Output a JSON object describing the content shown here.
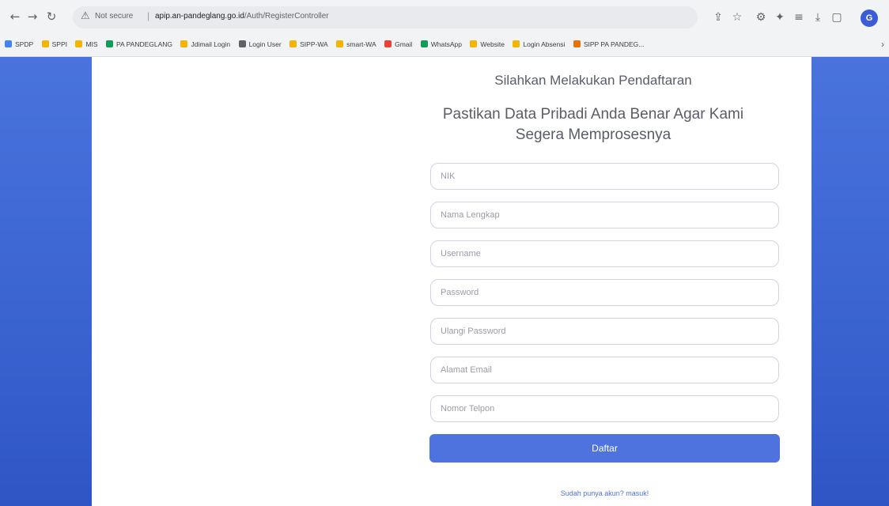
{
  "browser": {
    "security_label": "Not secure",
    "url_host": "apip.an-pandeglang.go.id",
    "url_path": "/Auth/RegisterController",
    "profile_initial": "G"
  },
  "bookmarks": [
    {
      "label": "SPDP",
      "color": "#4285f4"
    },
    {
      "label": "SPPI",
      "color": "#f4b400"
    },
    {
      "label": "MIS",
      "color": "#f4b400"
    },
    {
      "label": "PA PANDEGLANG",
      "color": "#0f9d58"
    },
    {
      "label": "Jdimail Login",
      "color": "#f4b400"
    },
    {
      "label": "Login User",
      "color": "#5f6368"
    },
    {
      "label": "SIPP-WA",
      "color": "#f4b400"
    },
    {
      "label": "smart-WA",
      "color": "#f4b400"
    },
    {
      "label": "Gmail",
      "color": "#ea4335"
    },
    {
      "label": "WhatsApp",
      "color": "#0f9d58"
    },
    {
      "label": "Website",
      "color": "#f4b400"
    },
    {
      "label": "Login Absensi",
      "color": "#f4b400"
    },
    {
      "label": "SIPP PA PANDEG...",
      "color": "#e8710a"
    }
  ],
  "form": {
    "heading": "Silahkan Melakukan Pendaftaran",
    "subheading": "Pastikan Data Pribadi Anda Benar Agar Kami Segera Memprosesnya",
    "fields": {
      "nik": {
        "placeholder": "NIK",
        "value": ""
      },
      "nama": {
        "placeholder": "Nama Lengkap",
        "value": ""
      },
      "username": {
        "placeholder": "Username",
        "value": ""
      },
      "password": {
        "placeholder": "Password",
        "value": ""
      },
      "ulangi_password": {
        "placeholder": "Ulangi Password",
        "value": ""
      },
      "email": {
        "placeholder": "Alamat Email",
        "value": ""
      },
      "telepon": {
        "placeholder": "Nomor Telpon",
        "value": ""
      }
    },
    "submit_label": "Daftar",
    "login_link": "Sudah punya akun? masuk!"
  },
  "colors": {
    "primary": "#4e73df",
    "background_gradient": "#3a63d0",
    "card": "#ffffff"
  }
}
